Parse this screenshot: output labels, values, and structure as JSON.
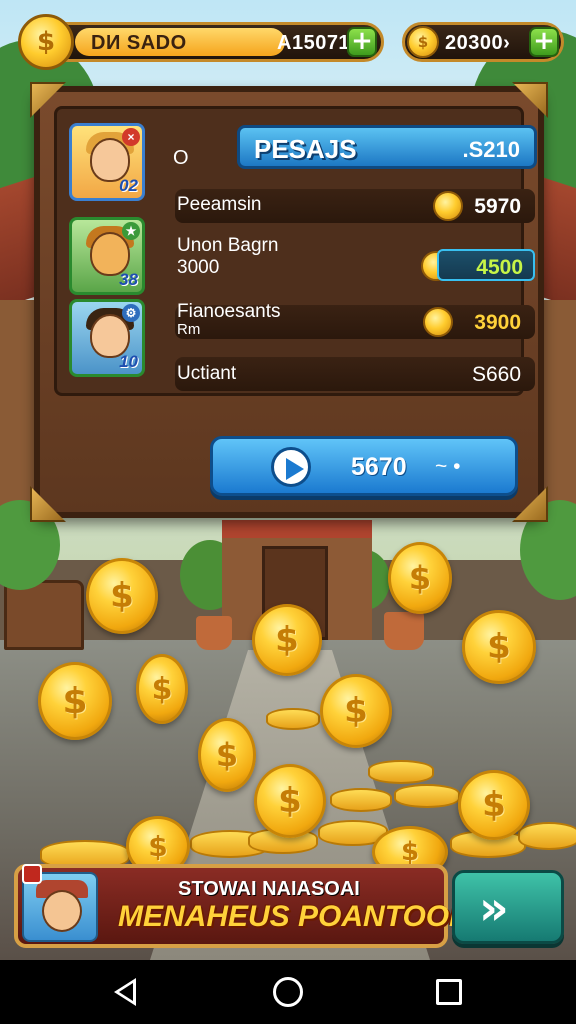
{
  "top_bar": {
    "coin_symbol": "$",
    "label": "DИ SADO",
    "value": "A15071",
    "plus": "+",
    "secondary_coin_value": "20300›"
  },
  "panel": {
    "header_title": "PESAJS",
    "header_value": ".S210",
    "header_marker": "O",
    "players": [
      {
        "avatar_number": "02",
        "name": "Peeamsin",
        "value": "5970"
      },
      {
        "avatar_number": "38",
        "name": "Unon Bagrn",
        "sub": "3000",
        "value": "4500"
      },
      {
        "avatar_number": "10",
        "name": "Fianoesants",
        "sub": "Rm",
        "value": "3900"
      }
    ],
    "footer_label": "Uctiant",
    "footer_value": "S660",
    "play_button": {
      "value": "5670",
      "suffix": "~ •"
    }
  },
  "banner": {
    "line1": "STOWAI NAIASOAI",
    "line2": "MENAHEUS POANTOOIA!!",
    "next_icon": "»"
  },
  "coin_symbol": "$",
  "colors": {
    "accent_gold": "#ffcc2e",
    "panel_wood": "#6b3f24",
    "button_blue": "#1b7ad0",
    "highlight_green": "#c7f547",
    "next_button_teal": "#167a72"
  },
  "icons": [
    "plus-icon",
    "coin-icon",
    "play-icon",
    "double-chevron-icon",
    "nav-back-icon",
    "nav-home-icon",
    "nav-recents-icon"
  ]
}
